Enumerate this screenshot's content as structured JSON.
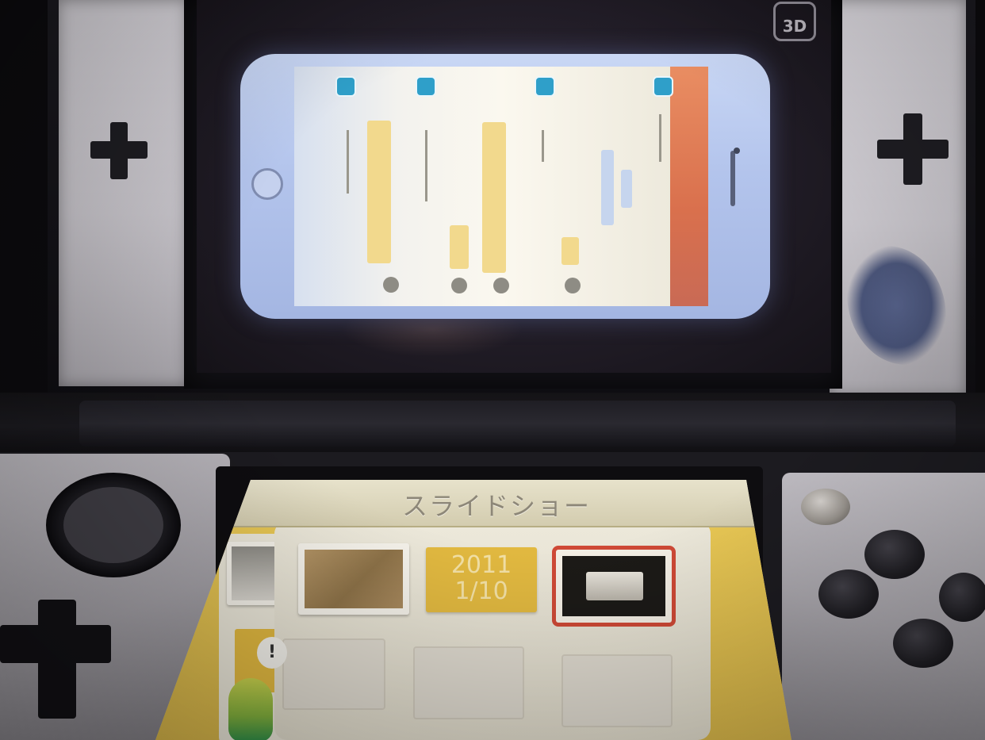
{
  "upper_screen": {
    "logo_3d": "3D"
  },
  "lower_screen": {
    "title": "スライドショー",
    "date_card": {
      "year": "2011",
      "date": "1/10"
    },
    "speech_bubble": "!"
  },
  "colors": {
    "title_bar": "#d3ccaf",
    "panel_yellow": "#e8c754",
    "selection_red": "#cf4936",
    "phone_header_orange": "#e98d62",
    "chat_icon_blue": "#2f9fc9"
  }
}
